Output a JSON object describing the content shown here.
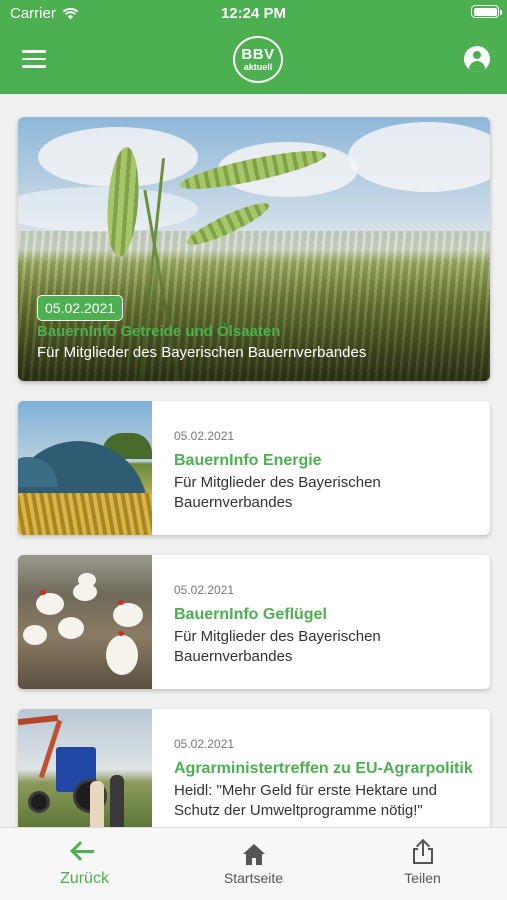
{
  "status_bar": {
    "carrier": "Carrier",
    "time": "12:24 PM"
  },
  "app_bar": {
    "logo_line1": "BBV",
    "logo_line2": "aktuell",
    "menu_icon": "hamburger-menu-icon",
    "account_icon": "account-circle-icon",
    "color": "#4caf50"
  },
  "featured": {
    "date": "05.02.2021",
    "title": "BauernInfo Getreide und Ölsaaten",
    "subtitle": "Für Mitglieder des Bayerischen Bauernverbandes"
  },
  "articles": [
    {
      "date": "05.02.2021",
      "title": "BauernInfo Energie",
      "desc": "Für Mitglieder des Bayerischen Bauernverbandes"
    },
    {
      "date": "05.02.2021",
      "title": "BauernInfo Geflügel",
      "desc": "Für Mitglieder des Bayerischen Bauernverbandes"
    },
    {
      "date": "05.02.2021",
      "title": "Agrarministertreffen zu EU-Agrarpolitik",
      "desc": "Heidl: \"Mehr Geld für erste Hektare und Schutz der Umweltprogramme nötig!\""
    }
  ],
  "tabbar": {
    "back_label": "Zurück",
    "home_label": "Startseite",
    "share_label": "Teilen"
  }
}
